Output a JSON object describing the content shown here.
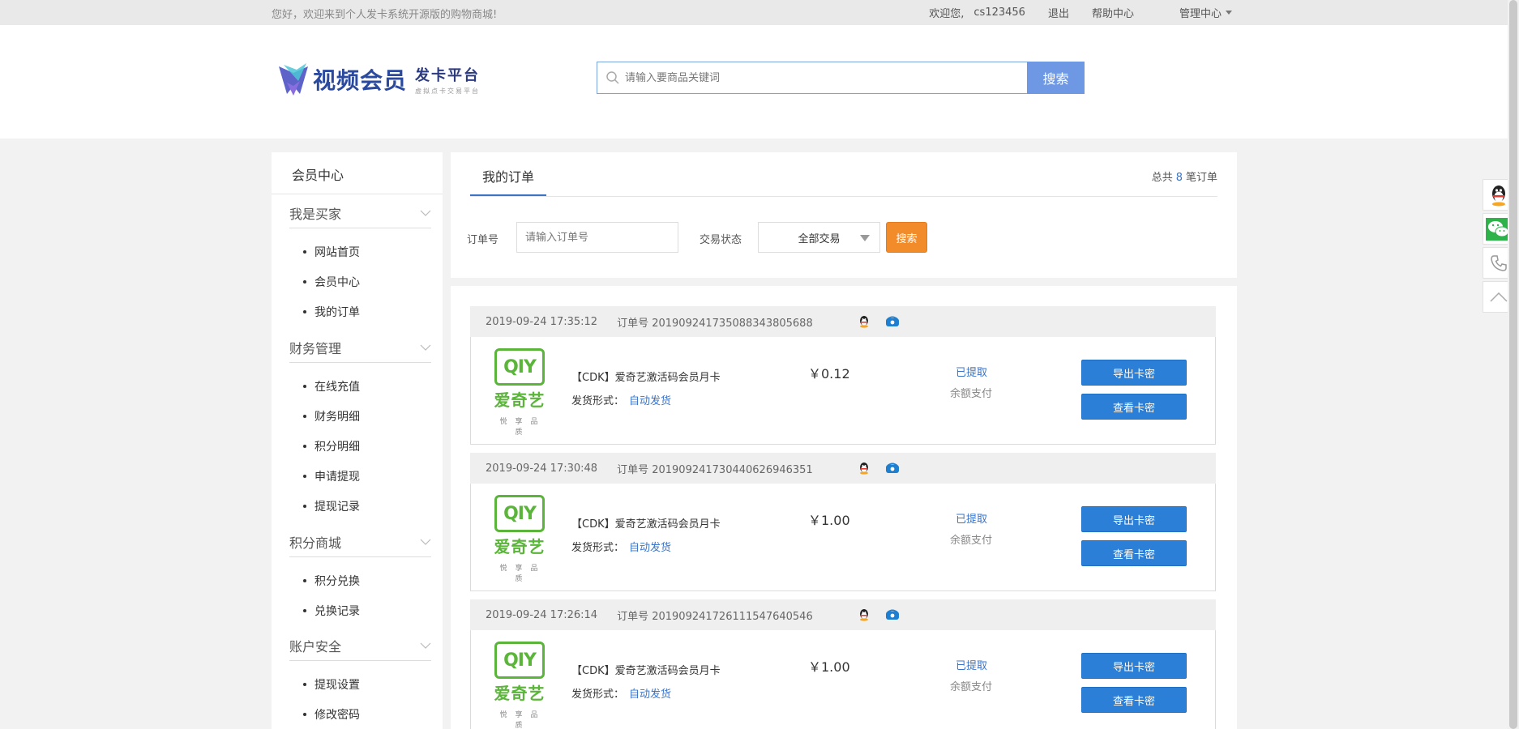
{
  "topbar": {
    "welcome": "您好，欢迎来到个人发卡系统开源版的购物商城!",
    "greeting": "欢迎您,",
    "username": "cs123456",
    "logout": "退出",
    "help": "帮助中心",
    "admin": "管理中心"
  },
  "header": {
    "logo_text": "视频会员",
    "logo_sub": "发卡平台",
    "logo_sub_small": "虚拟点卡交易平台",
    "search_placeholder": "请输入要商品关键词",
    "search_button": "搜索"
  },
  "sidebar": {
    "title": "会员中心",
    "groups": [
      {
        "label": "我是买家",
        "items": [
          "网站首页",
          "会员中心",
          "我的订单"
        ]
      },
      {
        "label": "财务管理",
        "items": [
          "在线充值",
          "财务明细",
          "积分明细",
          "申请提现",
          "提现记录"
        ]
      },
      {
        "label": "积分商城",
        "items": [
          "积分兑换",
          "兑换记录"
        ]
      },
      {
        "label": "账户安全",
        "items": [
          "提现设置",
          "修改密码"
        ]
      }
    ]
  },
  "main": {
    "tab": "我的订单",
    "total_prefix": "总共",
    "total_count": "8",
    "total_suffix": "笔订单",
    "filter": {
      "order_label": "订单号",
      "order_placeholder": "请输入订单号",
      "status_label": "交易状态",
      "status_value": "全部交易",
      "search_button": "搜索"
    },
    "orders": [
      {
        "time": "2019-09-24 17:35:12",
        "order_no": "订单号 20190924173508834380568​8",
        "product": "【CDK】爱奇艺激活码会员月卡",
        "ship_label": "发货形式：",
        "ship_value": "自动发货",
        "price": "￥0.12",
        "state": "已提取",
        "pay": "余额支付",
        "btn_export": "导出卡密",
        "btn_view": "查看卡密"
      },
      {
        "time": "2019-09-24 17:30:48",
        "order_no": "订单号 20190924173044062694635​1",
        "product": "【CDK】爱奇艺激活码会员月卡",
        "ship_label": "发货形式：",
        "ship_value": "自动发货",
        "price": "￥1.00",
        "state": "已提取",
        "pay": "余额支付",
        "btn_export": "导出卡密",
        "btn_view": "查看卡密"
      },
      {
        "time": "2019-09-24 17:26:14",
        "order_no": "订单号 20190924172611154764054​6",
        "product": "【CDK】爱奇艺激活码会员月卡",
        "ship_label": "发货形式：",
        "ship_value": "自动发货",
        "price": "￥1.00",
        "state": "已提取",
        "pay": "余额支付",
        "btn_export": "导出卡密",
        "btn_view": "查看卡密"
      }
    ],
    "brand": {
      "badge": "QIY",
      "cn": "爱奇艺",
      "slogan": "悦享品质"
    }
  },
  "colors": {
    "accent": "#2b7fd6",
    "link": "#3b74c7",
    "orange": "#f28b2a",
    "iqiyi_green": "#5bb53a"
  }
}
